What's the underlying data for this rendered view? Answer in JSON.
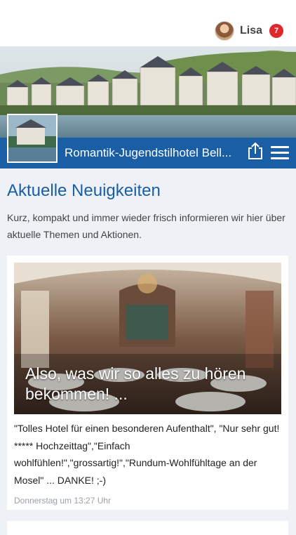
{
  "user": {
    "name": "Lisa",
    "notifications": "7"
  },
  "hotel": {
    "title": "Romantik-Jugendstilhotel Bell..."
  },
  "section": {
    "headline": "Aktuelle Neuigkeiten",
    "intro": "Kurz, kompakt und immer wieder frisch informieren wir hier über aktuelle Themen und Aktionen."
  },
  "post": {
    "title": "Also, was wir so alles zu hören bekommen! ...",
    "text": "\"Tolles Hotel für einen besonderen Aufenthalt\", \"Nur sehr gut! ***** Hochzeittag\",\"Einfach wohlfühlen!\",\"grossartig!\",\"Rundum-Wohlfühltage an der Mosel\" ... DANKE! ;-)",
    "date": "Donnerstag um 13:27 Uhr"
  },
  "icons": {
    "share": "share-icon",
    "menu": "hamburger-menu-icon"
  },
  "colors": {
    "brand": "#1a5ea6",
    "badge": "#e0282c",
    "background": "#eef1f5"
  }
}
